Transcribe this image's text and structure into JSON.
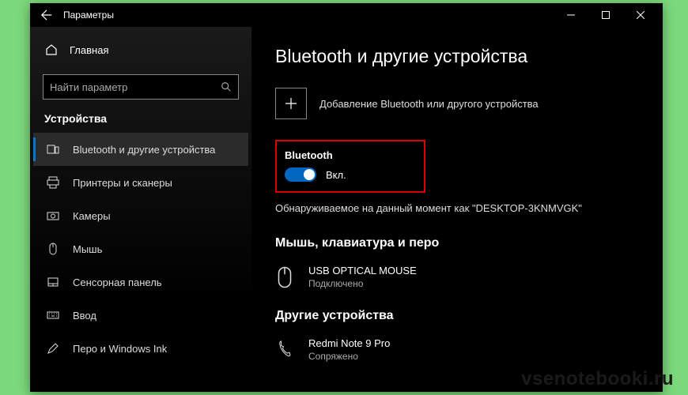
{
  "titlebar": {
    "title": "Параметры"
  },
  "sidebar": {
    "home_label": "Главная",
    "search_placeholder": "Найти параметр",
    "group_label": "Устройства",
    "items": [
      {
        "label": "Bluetooth и другие устройства"
      },
      {
        "label": "Принтеры и сканеры"
      },
      {
        "label": "Камеры"
      },
      {
        "label": "Мышь"
      },
      {
        "label": "Сенсорная панель"
      },
      {
        "label": "Ввод"
      },
      {
        "label": "Перо и Windows Ink"
      }
    ]
  },
  "main": {
    "heading": "Bluetooth и другие устройства",
    "add_label": "Добавление Bluetooth или другого устройства",
    "bt_label": "Bluetooth",
    "bt_state": "Вкл.",
    "discover_text": "Обнаруживаемое на данный момент как \"DESKTOP-3KNMVGK\"",
    "section1": "Мышь, клавиатура и перо",
    "dev1_name": "USB OPTICAL MOUSE",
    "dev1_status": "Подключено",
    "section2": "Другие устройства",
    "dev2_name": "Redmi Note 9 Pro",
    "dev2_status": "Сопряжено"
  },
  "watermark": "vsenotebooki.ru"
}
